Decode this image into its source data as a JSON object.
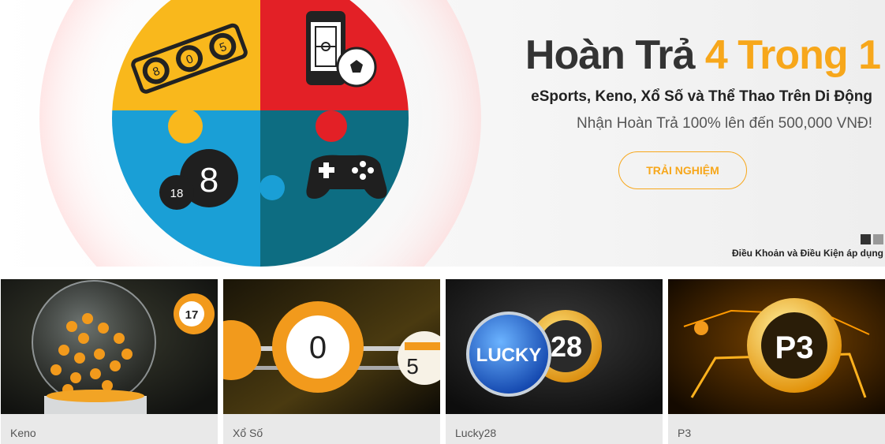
{
  "hero": {
    "title_main": "Hoàn Trả ",
    "title_accent": "4 Trong 1",
    "subtitle": "eSports, Keno, Xổ Số và Thể Thao Trên Di Động",
    "description": "Nhận Hoàn Trả 100% lên đến 500,000 VNĐ!",
    "cta_label": "TRẢI NGHIỆM",
    "terms": "Điều Khoản và Điều Kiện áp dụng",
    "puzzle_numbers": {
      "lottery_balls": [
        "8",
        "0",
        "5"
      ],
      "number_main": "8",
      "number_small": "18"
    },
    "colors": {
      "accent": "#f7a71b",
      "yellow": "#f9b81c",
      "red": "#e32026",
      "blue": "#1a9fd6",
      "teal": "#0d6d82"
    }
  },
  "carousel": {
    "slides": 2,
    "active": 0
  },
  "games": [
    {
      "label": "Keno",
      "ball_number": "17"
    },
    {
      "label": "Xổ Số",
      "ball_number": "0",
      "ball_number_2": "5"
    },
    {
      "label": "Lucky28",
      "badge_text": "LUCKY",
      "badge_number": "28"
    },
    {
      "label": "P3",
      "badge_text": "P3"
    }
  ]
}
